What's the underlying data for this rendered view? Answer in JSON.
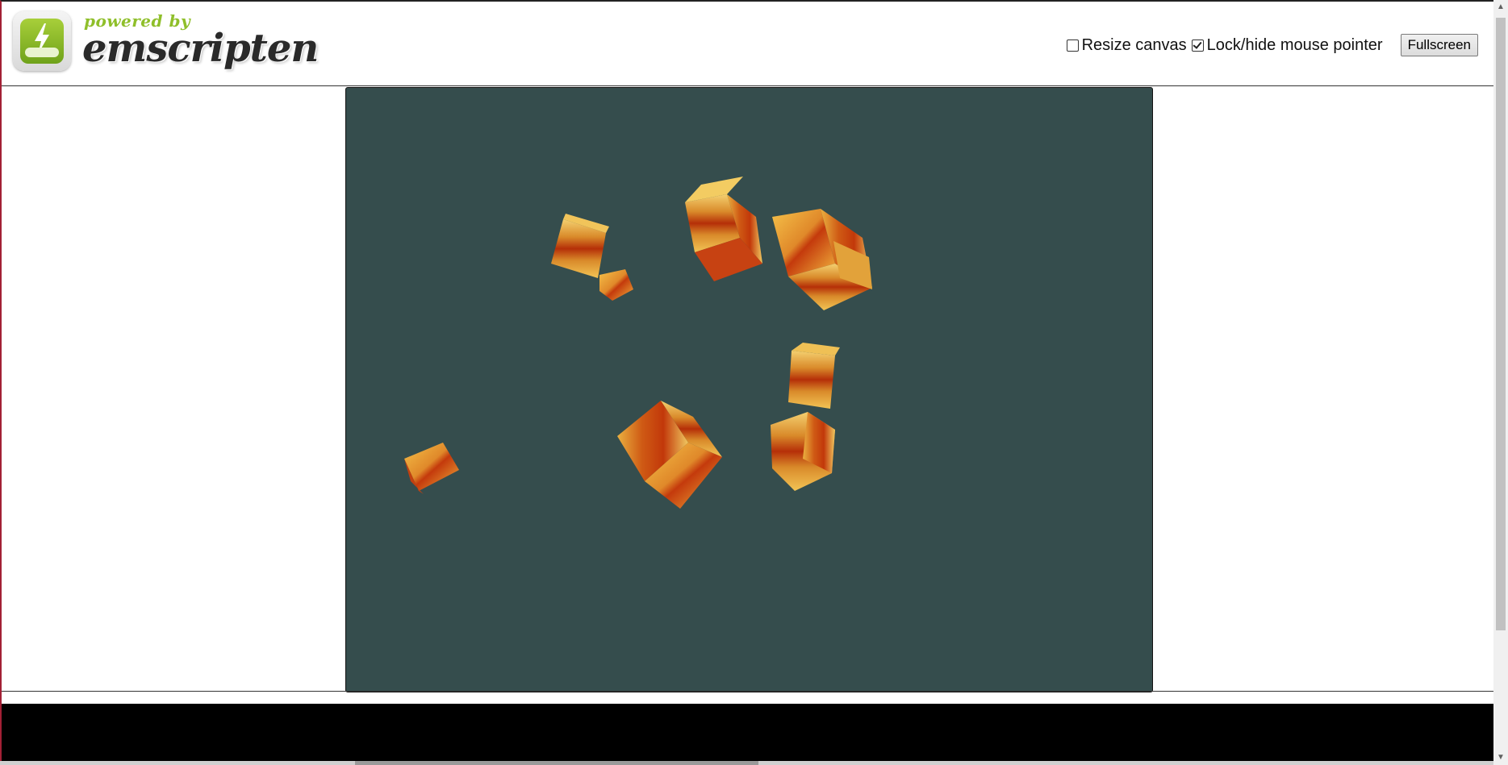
{
  "header": {
    "logo": {
      "powered_by": "powered by",
      "name": "emscripten"
    },
    "controls": {
      "resize_canvas": {
        "label": "Resize canvas",
        "checked": false
      },
      "lock_pointer": {
        "label": "Lock/hide mouse pointer",
        "checked": true
      },
      "fullscreen_label": "Fullscreen"
    }
  },
  "canvas": {
    "background_color": "#354d4d",
    "scene": "rotating textured cubes"
  },
  "colors": {
    "logo_green": "#8fbf2a",
    "console_bg": "#000000"
  }
}
